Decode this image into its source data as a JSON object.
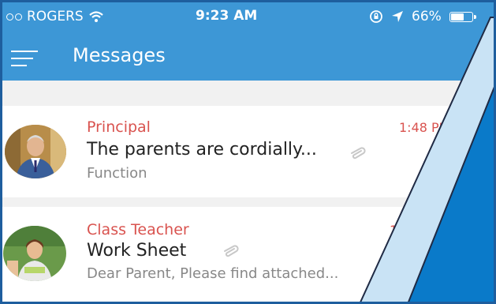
{
  "status_bar": {
    "carrier": "ROGERS",
    "time": "9:23 AM",
    "battery_percent": "66%",
    "battery_level": 0.66,
    "icons": [
      "signal-dots-icon",
      "wifi-icon",
      "orientation-lock-icon",
      "location-arrow-icon",
      "battery-icon"
    ]
  },
  "header": {
    "title": "Messages",
    "menu_icon": "hamburger-menu-icon"
  },
  "messages": [
    {
      "sender": "Principal",
      "time": "1:48 PI",
      "subject": "The parents are cordially...",
      "preview": "Function",
      "has_attachment": true
    },
    {
      "sender": "Class Teacher",
      "time": "1",
      "subject": "Work Sheet",
      "preview": "Dear Parent, Please find attached...",
      "has_attachment": true
    }
  ],
  "colors": {
    "header": "#3d97d6",
    "sender": "#d9534f",
    "overlay_light": "#c9e3f5",
    "overlay_dark": "#0a7ac9"
  }
}
